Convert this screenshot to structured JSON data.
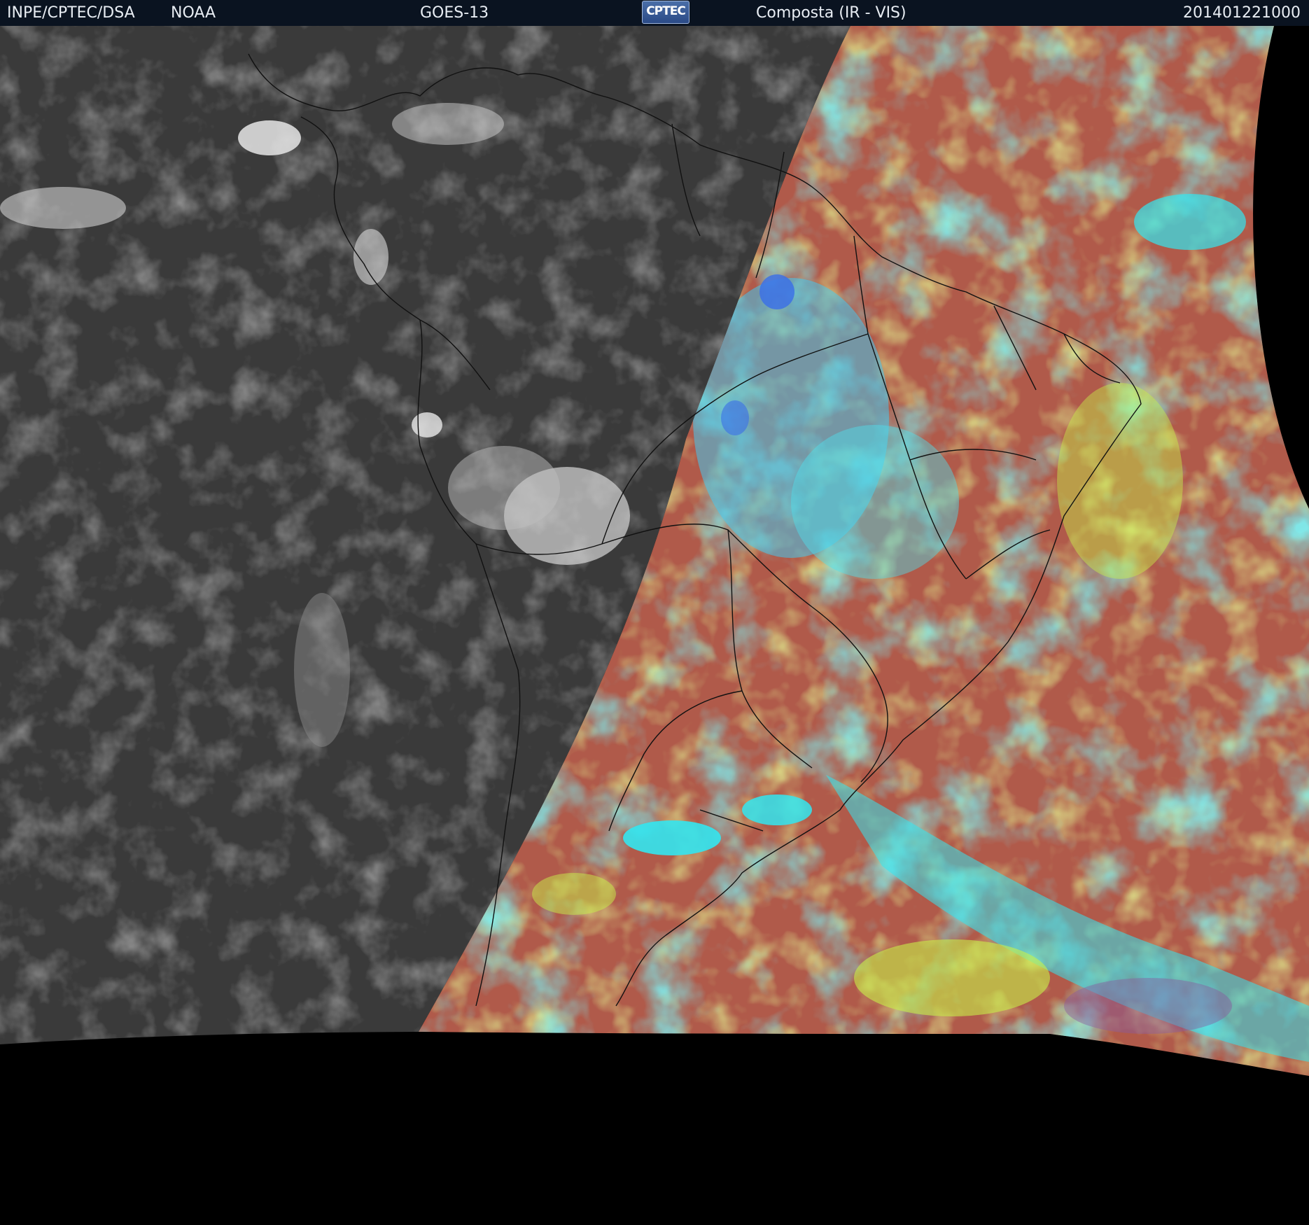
{
  "header": {
    "agency": "INPE/CPTEC/DSA",
    "source": "NOAA",
    "satellite": "GOES-13",
    "logo_text": "CPTEC",
    "product": "Composta (IR - VIS)",
    "timestamp": "201401221000"
  },
  "map": {
    "night_side_color": "#3a3a3a",
    "day_side_colors": [
      "#b05a4a",
      "#33e6f0",
      "#c8f04a",
      "#8a5aa0"
    ],
    "background_color": "#000000",
    "border_color": "#111111"
  }
}
